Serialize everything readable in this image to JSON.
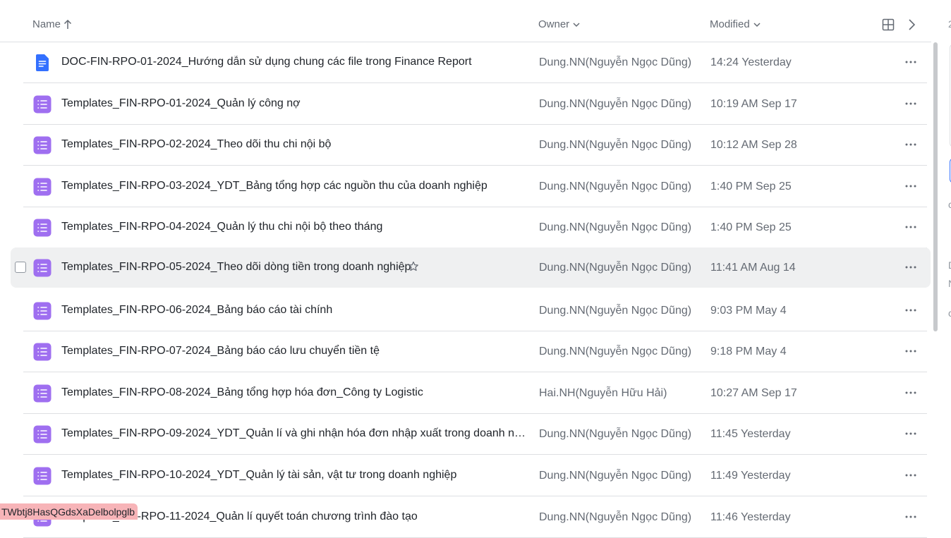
{
  "header": {
    "name_label": "Name",
    "owner_label": "Owner",
    "modified_label": "Modified",
    "sort_icon": "arrow-up-icon",
    "grid_icon": "grid-view-icon",
    "next_icon": "chevron-right-icon"
  },
  "rows": [
    {
      "type": "doc",
      "name": "DOC-FIN-RPO-01-2024_Hướng dẫn sử dụng chung các file trong Finance Report",
      "owner": "Dung.NN(Nguyễn Ngọc Dũng)",
      "modified": "14:24 Yesterday"
    },
    {
      "type": "base",
      "name": "Templates_FIN-RPO-01-2024_Quản lý công nợ",
      "owner": "Dung.NN(Nguyễn Ngọc Dũng)",
      "modified": "10:19 AM Sep 17"
    },
    {
      "type": "base",
      "name": "Templates_FIN-RPO-02-2024_Theo dõi thu chi nội bộ",
      "owner": "Dung.NN(Nguyễn Ngọc Dũng)",
      "modified": "10:12 AM Sep 28"
    },
    {
      "type": "base",
      "name": "Templates_FIN-RPO-03-2024_YDT_Bảng tổng hợp các nguồn thu của doanh nghiệp",
      "owner": "Dung.NN(Nguyễn Ngọc Dũng)",
      "modified": "1:40 PM Sep 25"
    },
    {
      "type": "base",
      "name": "Templates_FIN-RPO-04-2024_Quản lý thu chi nội bộ theo tháng",
      "owner": "Dung.NN(Nguyễn Ngọc Dũng)",
      "modified": "1:40 PM Sep 25"
    },
    {
      "type": "base",
      "name": "Templates_FIN-RPO-05-2024_Theo dõi dòng tiền trong doanh nghiệp",
      "owner": "Dung.NN(Nguyễn Ngọc Dũng)",
      "modified": "11:41 AM Aug 14",
      "hover": true
    },
    {
      "type": "base",
      "name": "Templates_FIN-RPO-06-2024_Bảng báo cáo tài chính",
      "owner": "Dung.NN(Nguyễn Ngọc Dũng)",
      "modified": "9:03 PM May 4"
    },
    {
      "type": "base",
      "name": "Templates_FIN-RPO-07-2024_Bảng báo cáo lưu chuyển tiền tệ",
      "owner": "Dung.NN(Nguyễn Ngọc Dũng)",
      "modified": "9:18 PM May 4"
    },
    {
      "type": "base",
      "name": "Templates_FIN-RPO-08-2024_Bảng tổng hợp hóa đơn_Công ty Logistic",
      "owner": "Hai.NH(Nguyễn Hữu Hải)",
      "modified": "10:27 AM Sep 17"
    },
    {
      "type": "base",
      "name": "Templates_FIN-RPO-09-2024_YDT_Quản lí và ghi nhận hóa đơn nhập xuất trong doanh nghi...",
      "owner": "Dung.NN(Nguyễn Ngọc Dũng)",
      "modified": "11:45 Yesterday"
    },
    {
      "type": "base",
      "name": "Templates_FIN-RPO-10-2024_YDT_Quản lý tài sản, vật tư trong doanh nghiệp",
      "owner": "Dung.NN(Nguyễn Ngọc Dũng)",
      "modified": "11:49 Yesterday"
    },
    {
      "type": "base",
      "name": "Templates_FIN-RPO-11-2024_Quản lí quyết toán chương trình đào tạo",
      "owner": "Dung.NN(Nguyễn Ngọc Dũng)",
      "modified": "11:46 Yesterday"
    }
  ],
  "right_panel_chars": [
    "2",
    "c",
    "D",
    "N",
    "c"
  ],
  "token_text": "TWbtj8HasQGdsXaDelbolpglb",
  "colors": {
    "doc_icon": "#3370ff",
    "base_icon": "#9f6ff0",
    "hover_row": "#eff0f1",
    "token_bg": "#f7b4b8"
  }
}
